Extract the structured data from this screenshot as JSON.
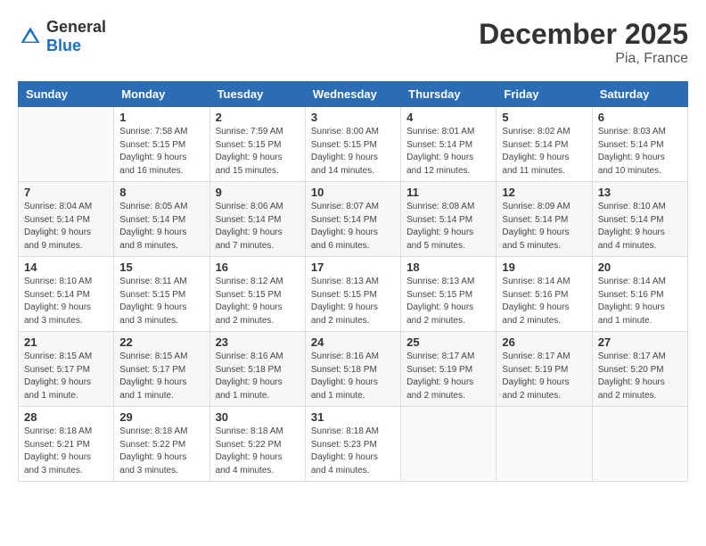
{
  "header": {
    "logo_general": "General",
    "logo_blue": "Blue",
    "month": "December 2025",
    "location": "Pia, France"
  },
  "days_of_week": [
    "Sunday",
    "Monday",
    "Tuesday",
    "Wednesday",
    "Thursday",
    "Friday",
    "Saturday"
  ],
  "weeks": [
    [
      {
        "day": "",
        "info": ""
      },
      {
        "day": "1",
        "info": "Sunrise: 7:58 AM\nSunset: 5:15 PM\nDaylight: 9 hours\nand 16 minutes."
      },
      {
        "day": "2",
        "info": "Sunrise: 7:59 AM\nSunset: 5:15 PM\nDaylight: 9 hours\nand 15 minutes."
      },
      {
        "day": "3",
        "info": "Sunrise: 8:00 AM\nSunset: 5:15 PM\nDaylight: 9 hours\nand 14 minutes."
      },
      {
        "day": "4",
        "info": "Sunrise: 8:01 AM\nSunset: 5:14 PM\nDaylight: 9 hours\nand 12 minutes."
      },
      {
        "day": "5",
        "info": "Sunrise: 8:02 AM\nSunset: 5:14 PM\nDaylight: 9 hours\nand 11 minutes."
      },
      {
        "day": "6",
        "info": "Sunrise: 8:03 AM\nSunset: 5:14 PM\nDaylight: 9 hours\nand 10 minutes."
      }
    ],
    [
      {
        "day": "7",
        "info": "Sunrise: 8:04 AM\nSunset: 5:14 PM\nDaylight: 9 hours\nand 9 minutes."
      },
      {
        "day": "8",
        "info": "Sunrise: 8:05 AM\nSunset: 5:14 PM\nDaylight: 9 hours\nand 8 minutes."
      },
      {
        "day": "9",
        "info": "Sunrise: 8:06 AM\nSunset: 5:14 PM\nDaylight: 9 hours\nand 7 minutes."
      },
      {
        "day": "10",
        "info": "Sunrise: 8:07 AM\nSunset: 5:14 PM\nDaylight: 9 hours\nand 6 minutes."
      },
      {
        "day": "11",
        "info": "Sunrise: 8:08 AM\nSunset: 5:14 PM\nDaylight: 9 hours\nand 5 minutes."
      },
      {
        "day": "12",
        "info": "Sunrise: 8:09 AM\nSunset: 5:14 PM\nDaylight: 9 hours\nand 5 minutes."
      },
      {
        "day": "13",
        "info": "Sunrise: 8:10 AM\nSunset: 5:14 PM\nDaylight: 9 hours\nand 4 minutes."
      }
    ],
    [
      {
        "day": "14",
        "info": "Sunrise: 8:10 AM\nSunset: 5:14 PM\nDaylight: 9 hours\nand 3 minutes."
      },
      {
        "day": "15",
        "info": "Sunrise: 8:11 AM\nSunset: 5:15 PM\nDaylight: 9 hours\nand 3 minutes."
      },
      {
        "day": "16",
        "info": "Sunrise: 8:12 AM\nSunset: 5:15 PM\nDaylight: 9 hours\nand 2 minutes."
      },
      {
        "day": "17",
        "info": "Sunrise: 8:13 AM\nSunset: 5:15 PM\nDaylight: 9 hours\nand 2 minutes."
      },
      {
        "day": "18",
        "info": "Sunrise: 8:13 AM\nSunset: 5:15 PM\nDaylight: 9 hours\nand 2 minutes."
      },
      {
        "day": "19",
        "info": "Sunrise: 8:14 AM\nSunset: 5:16 PM\nDaylight: 9 hours\nand 2 minutes."
      },
      {
        "day": "20",
        "info": "Sunrise: 8:14 AM\nSunset: 5:16 PM\nDaylight: 9 hours\nand 1 minute."
      }
    ],
    [
      {
        "day": "21",
        "info": "Sunrise: 8:15 AM\nSunset: 5:17 PM\nDaylight: 9 hours\nand 1 minute."
      },
      {
        "day": "22",
        "info": "Sunrise: 8:15 AM\nSunset: 5:17 PM\nDaylight: 9 hours\nand 1 minute."
      },
      {
        "day": "23",
        "info": "Sunrise: 8:16 AM\nSunset: 5:18 PM\nDaylight: 9 hours\nand 1 minute."
      },
      {
        "day": "24",
        "info": "Sunrise: 8:16 AM\nSunset: 5:18 PM\nDaylight: 9 hours\nand 1 minute."
      },
      {
        "day": "25",
        "info": "Sunrise: 8:17 AM\nSunset: 5:19 PM\nDaylight: 9 hours\nand 2 minutes."
      },
      {
        "day": "26",
        "info": "Sunrise: 8:17 AM\nSunset: 5:19 PM\nDaylight: 9 hours\nand 2 minutes."
      },
      {
        "day": "27",
        "info": "Sunrise: 8:17 AM\nSunset: 5:20 PM\nDaylight: 9 hours\nand 2 minutes."
      }
    ],
    [
      {
        "day": "28",
        "info": "Sunrise: 8:18 AM\nSunset: 5:21 PM\nDaylight: 9 hours\nand 3 minutes."
      },
      {
        "day": "29",
        "info": "Sunrise: 8:18 AM\nSunset: 5:22 PM\nDaylight: 9 hours\nand 3 minutes."
      },
      {
        "day": "30",
        "info": "Sunrise: 8:18 AM\nSunset: 5:22 PM\nDaylight: 9 hours\nand 4 minutes."
      },
      {
        "day": "31",
        "info": "Sunrise: 8:18 AM\nSunset: 5:23 PM\nDaylight: 9 hours\nand 4 minutes."
      },
      {
        "day": "",
        "info": ""
      },
      {
        "day": "",
        "info": ""
      },
      {
        "day": "",
        "info": ""
      }
    ]
  ]
}
